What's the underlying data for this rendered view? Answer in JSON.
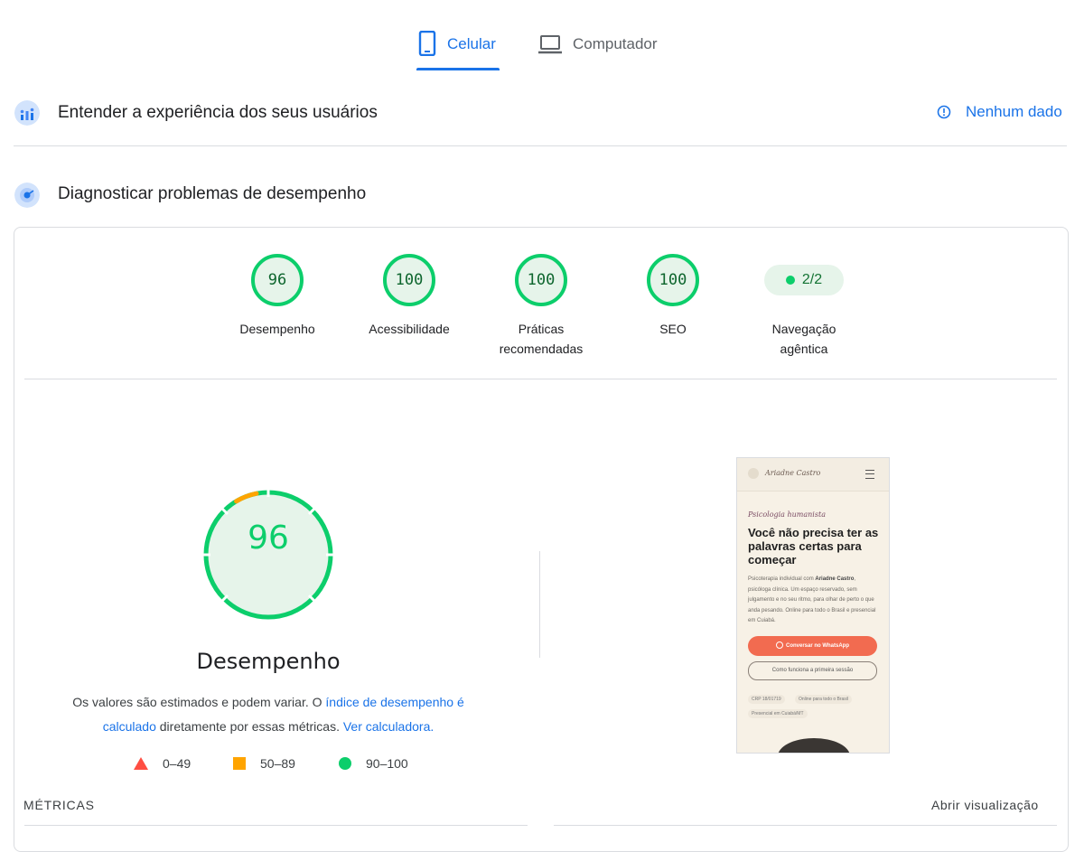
{
  "tabs": {
    "mobile": {
      "label": "Celular",
      "icon": "smartphone-icon"
    },
    "desktop": {
      "label": "Computador",
      "icon": "laptop-icon"
    }
  },
  "field_data": {
    "title": "Entender a experiência dos seus usuários",
    "status": "Nenhum dado",
    "icon": "people-chart-icon"
  },
  "diagnostics": {
    "title": "Diagnosticar problemas de desempenho",
    "icon": "radar-icon"
  },
  "categories": [
    {
      "score": "96",
      "label_line1": "Desempenho",
      "label_line2": ""
    },
    {
      "score": "100",
      "label_line1": "Acessibilidade",
      "label_line2": ""
    },
    {
      "score": "100",
      "label_line1": "Práticas",
      "label_line2": "recomendadas"
    },
    {
      "score": "100",
      "label_line1": "SEO",
      "label_line2": ""
    }
  ],
  "agentic": {
    "value": "2/2",
    "label_line1": "Navegação",
    "label_line2": "agêntica"
  },
  "performance": {
    "score": "96",
    "score_fraction": 0.96,
    "title": "Desempenho",
    "desc_pre": "Os valores são estimados e podem variar. O ",
    "desc_link1": "índice de desempenho é calculado",
    "desc_mid": " diretamente por essas métricas. ",
    "desc_link2": "Ver calculadora."
  },
  "legend": [
    {
      "range": "0–49",
      "shape": "triangle",
      "color": "#ff4e42"
    },
    {
      "range": "50–89",
      "shape": "square",
      "color": "#ffa400"
    },
    {
      "range": "90–100",
      "shape": "circle",
      "color": "#0cce6b"
    }
  ],
  "metrics": {
    "heading": "MÉTRICAS",
    "open_view": "Abrir visualização"
  },
  "screenshot": {
    "logo": "Ariadne Castro",
    "kicker": "Psicologia humanista",
    "headline": "Você não precisa ter as palavras certas para começar",
    "body_pre": "Psicoterapia individual com ",
    "body_name": "Ariadne Castro",
    "body_post": ", psicóloga clínica. Um espaço reservado, sem julgamento e no seu ritmo, para olhar de perto o que anda pesando. Online para todo o Brasil e presencial em Cuiabá.",
    "cta_primary": "Conversar no WhatsApp",
    "cta_secondary": "Como funciona a primeira sessão",
    "chip1": "CRP 18/01719",
    "chip2": "Online para todo o Brasil",
    "chip3": "Presencial em Cuiabá/MT"
  },
  "colors": {
    "accent": "#1a73e8",
    "pass": "#0cce6b",
    "average": "#ffa400",
    "fail": "#ff4e42"
  }
}
